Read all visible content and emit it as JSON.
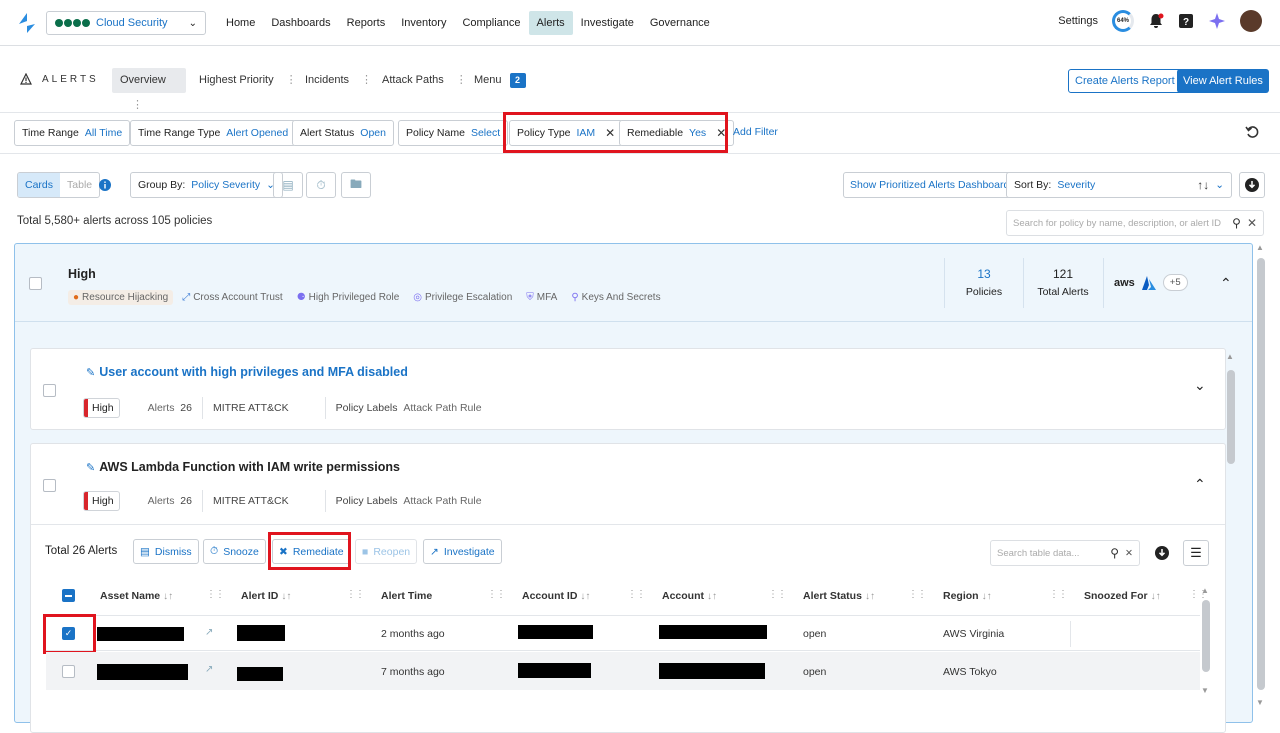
{
  "topnav": {
    "product": "Cloud Security",
    "items": [
      "Home",
      "Dashboards",
      "Reports",
      "Inventory",
      "Compliance",
      "Alerts",
      "Investigate",
      "Governance"
    ],
    "active": "Alerts",
    "settings": "Settings",
    "progress": "64%"
  },
  "alertsbar": {
    "title": "ALERTS",
    "tabs": [
      "Overview",
      "Highest Priority",
      "Incidents",
      "Attack Paths",
      "Menu"
    ],
    "menu_badge": "2",
    "create_report": "Create Alerts Report",
    "view_rules": "View Alert Rules"
  },
  "filters": [
    {
      "label": "Time Range",
      "value": "All Time"
    },
    {
      "label": "Time Range Type",
      "value": "Alert Opened"
    },
    {
      "label": "Alert Status",
      "value": "Open"
    },
    {
      "label": "Policy Name",
      "value": "Select"
    },
    {
      "label": "Policy Type",
      "value": "IAM"
    },
    {
      "label": "Remediable",
      "value": "Yes"
    }
  ],
  "add_filter": "Add Filter",
  "view": {
    "cards": "Cards",
    "table": "Table",
    "group_by_label": "Group By:",
    "group_by_value": "Policy Severity",
    "show_dashboard": "Show Prioritized Alerts Dashboard",
    "sort_label": "Sort By:",
    "sort_value": "Severity",
    "total": "Total 5,580+ alerts across 105 policies",
    "search_placeholder": "Search for policy by name, description, or alert ID"
  },
  "group": {
    "title": "High",
    "chips": [
      "Resource Hijacking",
      "Cross Account Trust",
      "High Privileged Role",
      "Privilege Escalation",
      "MFA",
      "Keys And Secrets"
    ],
    "policies_count": "13",
    "policies_label": "Policies",
    "alerts_count": "121",
    "alerts_label": "Total Alerts",
    "cloud_more": "+5",
    "aws": "aws"
  },
  "cards": [
    {
      "title": "User account with high privileges and MFA disabled",
      "severity": "High",
      "alerts_label": "Alerts",
      "alerts": "26",
      "mitre": "MITRE ATT&CK",
      "labels_label": "Policy Labels",
      "labels_value": "Attack Path Rule"
    },
    {
      "title": "AWS Lambda Function with IAM write permissions",
      "severity": "High",
      "alerts_label": "Alerts",
      "alerts": "26",
      "mitre": "MITRE ATT&CK",
      "labels_label": "Policy Labels",
      "labels_value": "Attack Path Rule"
    }
  ],
  "table": {
    "total": "Total 26 Alerts",
    "actions": [
      "Dismiss",
      "Snooze",
      "Remediate",
      "Reopen",
      "Investigate"
    ],
    "search_placeholder": "Search table data...",
    "columns": [
      "Asset Name",
      "Alert ID",
      "Alert Time",
      "Account ID",
      "Account",
      "Alert Status",
      "Region",
      "Snoozed For"
    ],
    "rows": [
      {
        "time": "2 months ago",
        "status": "open",
        "region": "AWS Virginia"
      },
      {
        "time": "7 months ago",
        "status": "open",
        "region": "AWS Tokyo"
      }
    ]
  },
  "colors": {
    "accent": "#1a73c6",
    "highlight": "#e0141e",
    "severity_high": "#d8262c"
  }
}
